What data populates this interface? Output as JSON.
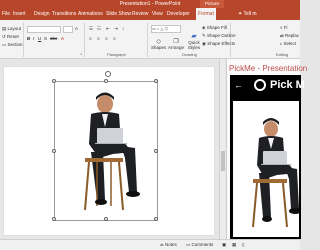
{
  "window": {
    "title": "Presentation1 - PowerPoint",
    "contextual_tab_group": "Picture Tools"
  },
  "tabs": [
    "File",
    "Insert",
    "Design",
    "Transitions",
    "Animations",
    "Slide Show",
    "Review",
    "View",
    "Developer",
    "Format"
  ],
  "tell_me": "Tell m",
  "ribbon": {
    "slides": {
      "layout": "Layout",
      "reset": "Reset",
      "section": "Section"
    },
    "paragraph_label": "Paragraph",
    "drawing": {
      "shapes": "Shapes",
      "arrange": "Arrange",
      "quick_styles": "Quick Styles",
      "label": "Drawing"
    },
    "shape_fill": "Shape Fill",
    "shape_outline": "Shape Outline",
    "shape_effects": "Shape Effects",
    "editing": {
      "find": "Fi",
      "replace": "Replac",
      "select": "Select",
      "label": "Editing"
    }
  },
  "statusbar": {
    "notes": "Notes",
    "comments": "Comments"
  },
  "addin": {
    "header": "PickMe - Presentation",
    "back_symbol": "←",
    "brand": "Pick M"
  },
  "colors": {
    "accent": "#b7472a",
    "addin_header": "#c0504d"
  }
}
